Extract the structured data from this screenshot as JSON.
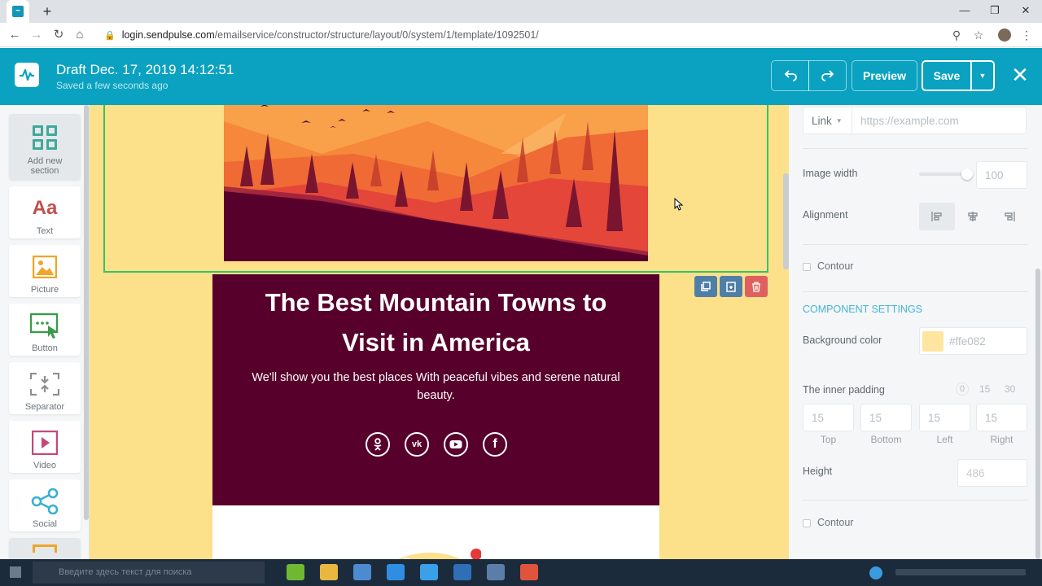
{
  "browser": {
    "url_host": "login.sendpulse.com",
    "url_path": "/emailservice/constructor/structure/layout/0/system/1/template/1092501/"
  },
  "header": {
    "title": "Draft Dec. 17, 2019 14:12:51",
    "saved_status": "Saved a few seconds ago",
    "preview_label": "Preview",
    "save_label": "Save"
  },
  "sidebar": {
    "items": [
      {
        "label": "Add new section",
        "icon": "add-section-icon"
      },
      {
        "label": "Text",
        "icon": "text-icon"
      },
      {
        "label": "Picture",
        "icon": "picture-icon"
      },
      {
        "label": "Button",
        "icon": "button-icon"
      },
      {
        "label": "Separator",
        "icon": "separator-icon"
      },
      {
        "label": "Video",
        "icon": "video-icon"
      },
      {
        "label": "Social",
        "icon": "social-icon"
      }
    ]
  },
  "canvas": {
    "headline": "The Best Mountain Towns to Visit in America",
    "subline": "We'll show you the best places With peaceful vibes and serene natural beauty.",
    "socials": [
      "odnoklassniki-icon",
      "vk-icon",
      "youtube-icon",
      "facebook-icon"
    ],
    "background_color": "#fce08a",
    "block_color": "#57002b"
  },
  "panel": {
    "link_label": "Link",
    "link_placeholder": "https://example.com",
    "image_width_label": "Image width",
    "image_width_value": "100",
    "alignment_label": "Alignment",
    "contour_label": "Contour",
    "section_title": "COMPONENT SETTINGS",
    "bg_color_label": "Background color",
    "bg_color_value": "#ffe082",
    "inner_padding_label": "The inner padding",
    "padding_presets": [
      "0",
      "15",
      "30"
    ],
    "padding": {
      "top": {
        "value": "15",
        "label": "Top"
      },
      "bottom": {
        "value": "15",
        "label": "Bottom"
      },
      "left": {
        "value": "15",
        "label": "Left"
      },
      "right": {
        "value": "15",
        "label": "Right"
      }
    },
    "height_label": "Height",
    "height_value": "486",
    "contour2_label": "Contour"
  },
  "taskbar": {
    "search_placeholder": "Введите здесь текст для поиска"
  }
}
